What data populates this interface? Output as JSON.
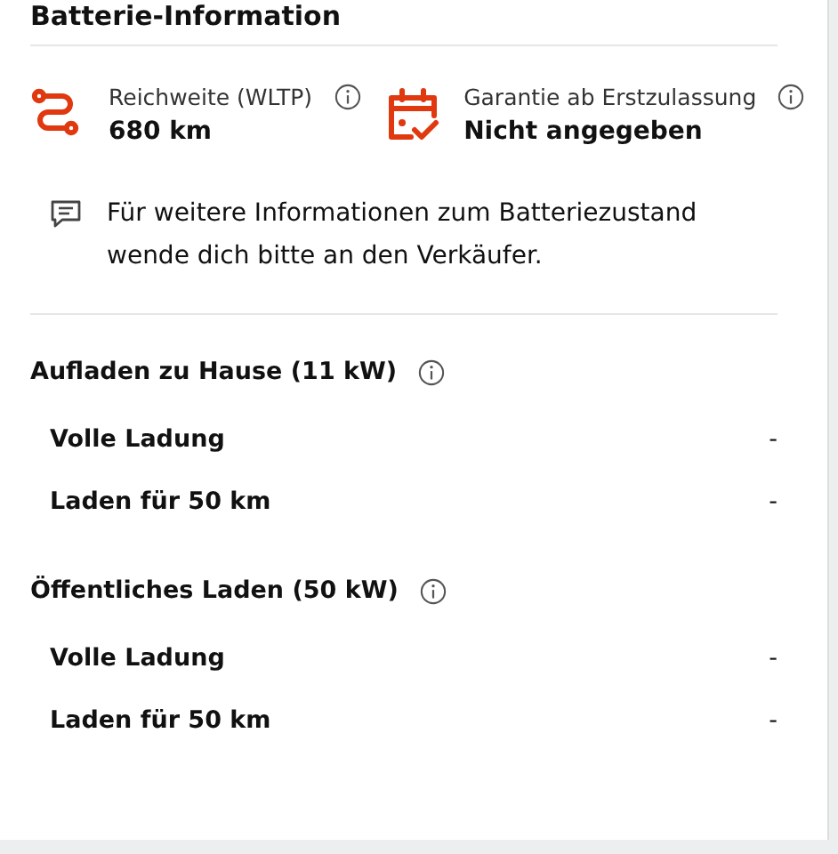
{
  "title": "Batterie-Information",
  "stats": [
    {
      "kind": "range",
      "label": "Reichweite (WLTP)",
      "value": "680 km"
    },
    {
      "kind": "warranty",
      "label": "Garantie ab Erstzulassung",
      "value": "Nicht angegeben"
    }
  ],
  "note": "Für weitere Informationen zum Batteriezustand wende dich bitte an den Verkäufer.",
  "sections": [
    {
      "heading": "Aufladen zu Hause (11 kW)",
      "rows": [
        {
          "label": "Volle Ladung",
          "value": "-"
        },
        {
          "label": "Laden für 50 km",
          "value": "-"
        }
      ]
    },
    {
      "heading": "Öffentliches Laden (50 kW)",
      "rows": [
        {
          "label": "Volle Ladung",
          "value": "-"
        },
        {
          "label": "Laden für 50 km",
          "value": "-"
        }
      ]
    }
  ]
}
